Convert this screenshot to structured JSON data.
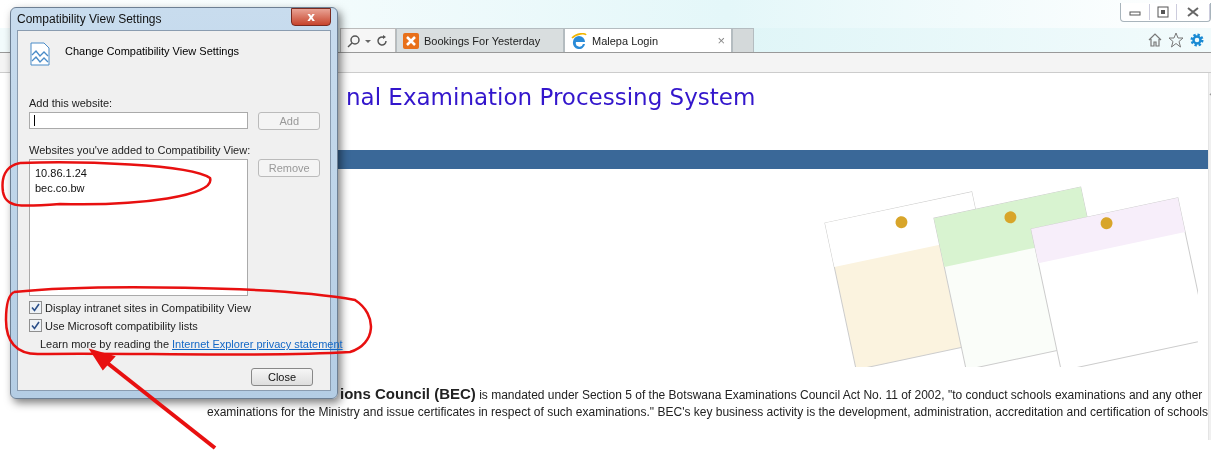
{
  "browser": {
    "tabs": [
      {
        "label": "Bookings For Yesterday",
        "selected": false
      },
      {
        "label": "Malepa Login",
        "selected": true
      }
    ],
    "tab_close": "×"
  },
  "page": {
    "heading": "nal Examination Processing System",
    "intro_line_1": "**ions Council (BEC)** is mandated under Section 5 of the Botswana Examinations Council Act No. 11 of 2002, \"to conduct schools examinations and any other",
    "intro_line_2": "examinations for the Ministry and issue certificates in respect of such examinations.\" BEC's key business activity is the development, administration, accreditation and certification of schools"
  },
  "dialog": {
    "title": "Compatibility View Settings",
    "close_glyph": "x",
    "header": "Change Compatibility View Settings",
    "add_label": "Add this website:",
    "add_button": {
      "label": "Add",
      "disabled": true
    },
    "list_label": "Websites you've added to Compatibility View:",
    "websites": [
      "10.86.1.24",
      "bec.co.bw"
    ],
    "remove_button": {
      "label": "Remove",
      "disabled": true
    },
    "options": [
      {
        "label": "Display intranet sites in Compatibility View",
        "checked": true
      },
      {
        "label": "Use Microsoft compatibility lists",
        "checked": true
      }
    ],
    "privacy_text": "Learn more by reading the",
    "privacy_link": "Internet Explorer privacy statement",
    "close_button": "Close"
  }
}
